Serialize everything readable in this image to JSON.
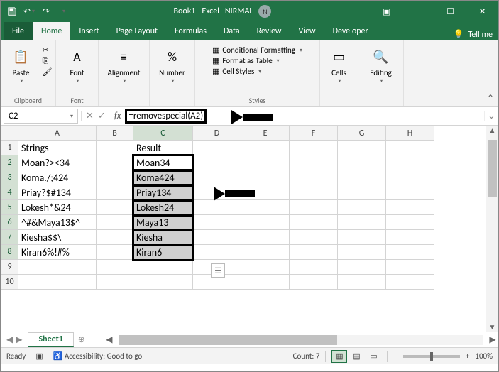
{
  "title": {
    "doc": "Book1 - Excel",
    "user": "NIRMAL",
    "initial": "N"
  },
  "tabs": {
    "file": "File",
    "home": "Home",
    "insert": "Insert",
    "pagelayout": "Page Layout",
    "formulas": "Formulas",
    "data": "Data",
    "review": "Review",
    "view": "View",
    "developer": "Developer",
    "tellme": "Tell me"
  },
  "ribbon": {
    "clipboard": {
      "label": "Clipboard",
      "paste": "Paste"
    },
    "font": {
      "label": "Font",
      "btn": "Font"
    },
    "alignment": {
      "label": "",
      "btn": "Alignment"
    },
    "number": {
      "label": "",
      "btn": "Number"
    },
    "styles": {
      "label": "Styles",
      "cond": "Conditional Formatting",
      "table": "Format as Table",
      "cell": "Cell Styles"
    },
    "cells": {
      "btn": "Cells"
    },
    "editing": {
      "btn": "Editing"
    }
  },
  "namebox": "C2",
  "formula": "=removespecial(A2)",
  "columns": [
    "A",
    "B",
    "C",
    "D",
    "E",
    "F",
    "G",
    "H"
  ],
  "rows": [
    "1",
    "2",
    "3",
    "4",
    "5",
    "6",
    "7",
    "8",
    "9",
    "10"
  ],
  "cells": {
    "A1": "Strings",
    "C1": "Result",
    "A2": "Moan?><34",
    "C2": "Moan34",
    "A3": "Koma./;424",
    "C3": "Koma424",
    "A4": "Priay?$#134",
    "C4": "Priay134",
    "A5": "Lokesh*&24",
    "C5": "Lokesh24",
    "A6": "^#&Maya13$^",
    "C6": "Maya13",
    "A7": "Kiesha$$\\",
    "C7": "Kiesha",
    "A8": "Kiran6%!#%",
    "C8": "Kiran6"
  },
  "sheettab": "Sheet1",
  "status": {
    "ready": "Ready",
    "access": "Accessibility: Good to go",
    "count": "Count: 7",
    "zoom": "100%"
  }
}
